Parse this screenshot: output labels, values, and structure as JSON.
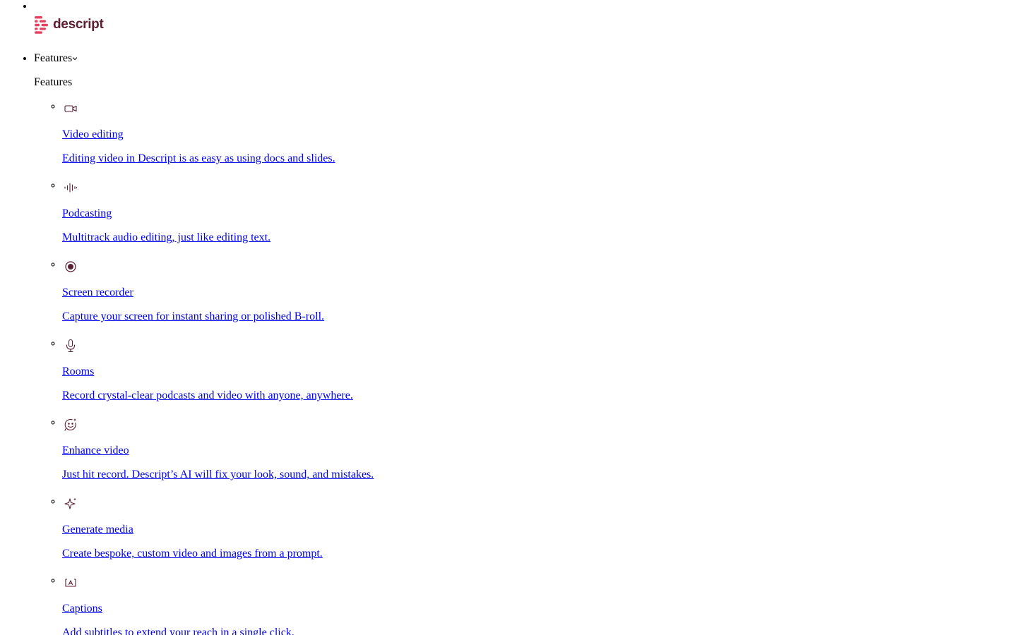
{
  "brand": {
    "name": "descript",
    "logo_icon": "descript-logo-icon",
    "color": "#5a1f33",
    "accent": "#e4405f"
  },
  "nav": {
    "features_label": "Features",
    "features_chevron_icon": "chevron-down-icon",
    "features_heading": "Features",
    "items": [
      {
        "icon": "video-camera-icon",
        "title": "Video editing",
        "desc": "Editing video in Descript is as easy as using docs and slides."
      },
      {
        "icon": "audio-waveform-icon",
        "title": "Podcasting",
        "desc": "Multitrack audio editing, just like editing text."
      },
      {
        "icon": "record-circle-icon",
        "title": "Screen recorder",
        "desc": "Capture your screen for instant sharing or polished B-roll."
      },
      {
        "icon": "microphone-icon",
        "title": "Rooms",
        "desc": "Record crystal-clear podcasts and video with anyone, anywhere."
      },
      {
        "icon": "smiley-sparkle-icon",
        "title": "Enhance video",
        "desc": "Just hit record. Descript’s AI will fix your look, sound, and mistakes."
      },
      {
        "icon": "sparkles-icon",
        "title": "Generate media",
        "desc": "Create bespoke, custom video and images from a prompt."
      },
      {
        "icon": "captions-icon",
        "title": "Captions",
        "desc": "Add subtitles to extend your reach in a single click."
      }
    ]
  },
  "colors": {
    "link": "#0000ee",
    "icon": "#5a1f33"
  }
}
